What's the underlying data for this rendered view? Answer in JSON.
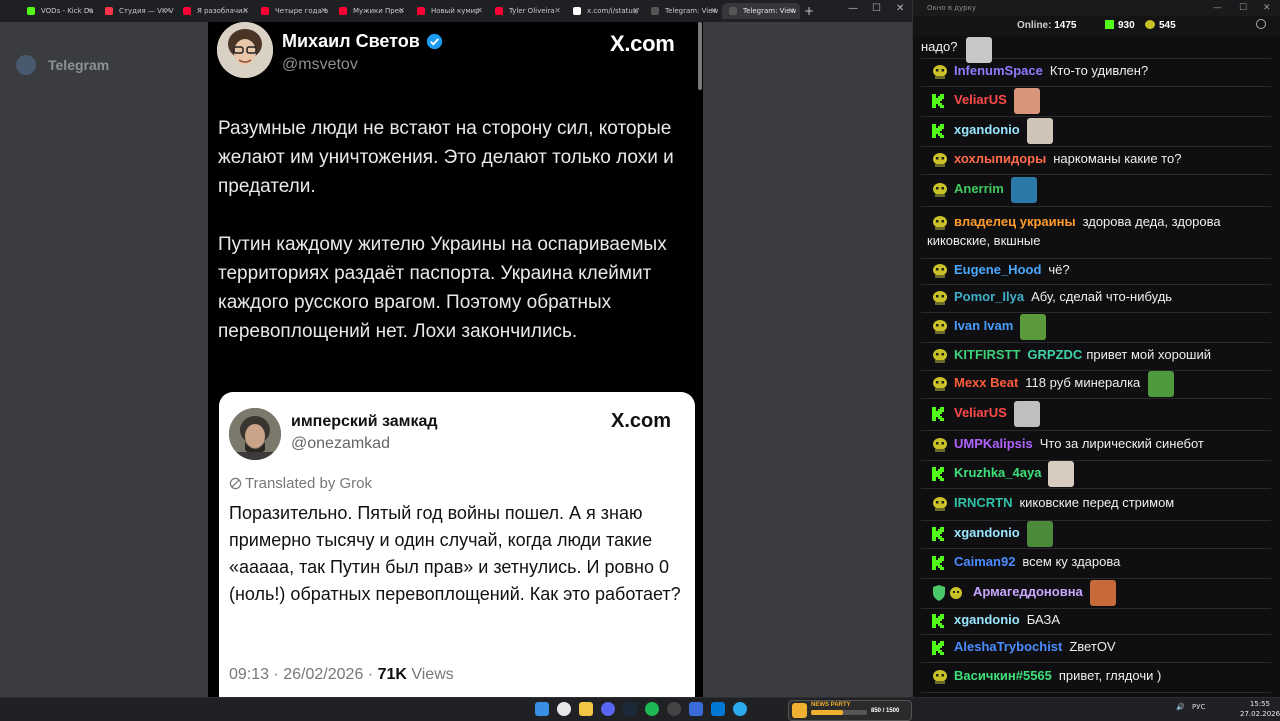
{
  "browser": {
    "tabs": [
      {
        "label": "VODs - Kick Da",
        "fav": "#53fc18"
      },
      {
        "label": "Студия — VK V",
        "fav": "#ff3347"
      },
      {
        "label": "Я разоблачил",
        "fav": "#ff0033"
      },
      {
        "label": "Четыре года в",
        "fav": "#ff0033"
      },
      {
        "label": "Мужики Прео",
        "fav": "#ff0033"
      },
      {
        "label": "Новый кумир",
        "fav": "#ff0033"
      },
      {
        "label": "Tyler Oliveira",
        "fav": "#ff0033"
      },
      {
        "label": "x.com/i/status/",
        "fav": "#ffffff"
      },
      {
        "label": "Telegram: View",
        "fav": "#555555"
      },
      {
        "label": "Telegram: View",
        "fav": "#555555"
      }
    ],
    "new_tab": "+",
    "window_controls": [
      "—",
      "☐",
      "✕"
    ]
  },
  "telegram_bg": {
    "title": "Telegram"
  },
  "tweet": {
    "author": "Михаил Светов",
    "handle": "@msvetov",
    "site": "X.com",
    "paragraphs": [
      "Разумные люди не встают на сторону сил, которые желают им уничтожения. Это делают только лохи и предатели.",
      "Путин каждому жителю Украины на оспариваемых территориях раздаёт паспорта. Украина клеймит каждого русского врагом. Поэтому обратных перевоплощений нет. Лохи закончились."
    ],
    "quote": {
      "author": "имперский замкад",
      "handle": "@onezamkad",
      "site": "X.com",
      "translated": "Translated by Grok",
      "body": "Поразительно. Пятый год войны пошел. А я знаю примерно тысячу и один случай, когда люди такие «ааааа, так Путин был прав» и зетнулись. И ровно 0 (ноль!) обратных перевоплощений. Как это работает?",
      "time": "09:13 · 26/02/2026 · ",
      "views_count": "71K",
      "views_label": " Views"
    }
  },
  "chat": {
    "window_title": "Окно в дурку",
    "online_label": "Online:",
    "online": "1475",
    "kick_count": "930",
    "other_count": "545",
    "messages": [
      {
        "user": "",
        "text": "надо?",
        "badge": "none",
        "color": "#ffffff",
        "emote": "#c8c8c8"
      },
      {
        "user": "InfenumSpace",
        "text": "Кто-то удивлен?",
        "badge": "yt",
        "color": "#8c7dff",
        "emote": ""
      },
      {
        "user": "VeliarUS",
        "text": "",
        "badge": "kick",
        "color": "#ff4a4a",
        "emote": "#d8957a"
      },
      {
        "user": "xgandonio",
        "text": "",
        "badge": "kick",
        "color": "#9be7ff",
        "emote": "#cfc4b6"
      },
      {
        "user": "хохлыпидоры",
        "text": "наркоманы какие то?",
        "badge": "yt",
        "color": "#ff6b4a",
        "emote": ""
      },
      {
        "user": "Anerrim",
        "text": "",
        "badge": "yt",
        "color": "#3ec95f",
        "emote": "#2a79a8"
      },
      {
        "user": "владелец украины",
        "text": "здорова деда, здорова",
        "text2": "киковские, вкшные",
        "badge": "yt",
        "color": "#ff9c2a",
        "emote": ""
      },
      {
        "user": "Eugene_Hood",
        "text": "чё?",
        "badge": "yt",
        "color": "#4aa8ff",
        "emote": ""
      },
      {
        "user": "Pomor_Ilya",
        "text": "Абу, сделай что-нибудь",
        "badge": "yt",
        "color": "#3fb0c9",
        "emote": ""
      },
      {
        "user": "Ivan Ivam",
        "text": "",
        "badge": "yt",
        "color": "#4a9dff",
        "emote": "#5a9a3a"
      },
      {
        "user": "KITFIRSTT",
        "mention": "GRPZDC",
        "text": "привет мой хороший",
        "badge": "yt",
        "color": "#3fd17a",
        "emote": ""
      },
      {
        "user": "Mexx Beat",
        "text": "118 руб минералка",
        "badge": "yt",
        "color": "#ff5c3a",
        "emote": "#4f9a3f"
      },
      {
        "user": "VeliarUS",
        "text": "",
        "badge": "kick",
        "color": "#ff4a4a",
        "emote": "#bfbfbf"
      },
      {
        "user": "UMPKalipsis",
        "text": "Что за лирический синебот",
        "badge": "yt",
        "color": "#b063ff",
        "emote": ""
      },
      {
        "user": "Kruzhka_4aya",
        "text": "",
        "badge": "kick",
        "color": "#3fe07a",
        "emote": "#d7ccbf"
      },
      {
        "user": "IRNCRTN",
        "text": "киковские перед стримом",
        "badge": "yt",
        "color": "#2fc2a8",
        "emote": ""
      },
      {
        "user": "xgandonio",
        "text": "",
        "badge": "kick",
        "color": "#9be7ff",
        "emote": "#4a8a3a"
      },
      {
        "user": "Caiman92",
        "text": "всем ку здарова",
        "badge": "kick",
        "color": "#4a8cff",
        "emote": ""
      },
      {
        "user": "Армагеддоновна",
        "text": "",
        "badge": "mod",
        "color": "#c9a6ff",
        "emote": "#c76a3a"
      },
      {
        "user": "xgandonio",
        "text": "БАЗА",
        "badge": "kick",
        "color": "#9be7ff",
        "emote": ""
      },
      {
        "user": "AleshaTrybochist",
        "text": "ZветOV",
        "badge": "kick",
        "color": "#4a8cff",
        "emote": ""
      },
      {
        "user": "Васичкин#5565",
        "text": "привет, глядочи )",
        "badge": "yt",
        "color": "#3fe07a",
        "emote": ""
      }
    ]
  },
  "taskbar": {
    "game_title": "NEWS PARTY",
    "game_count": "850 / 1500",
    "lang": "РУС",
    "time": "15:55",
    "date": "27.02.2026"
  },
  "colors": {
    "kick": "#53fc18",
    "yt_badge": "#c9c227",
    "tweet_bg": "#000000"
  }
}
